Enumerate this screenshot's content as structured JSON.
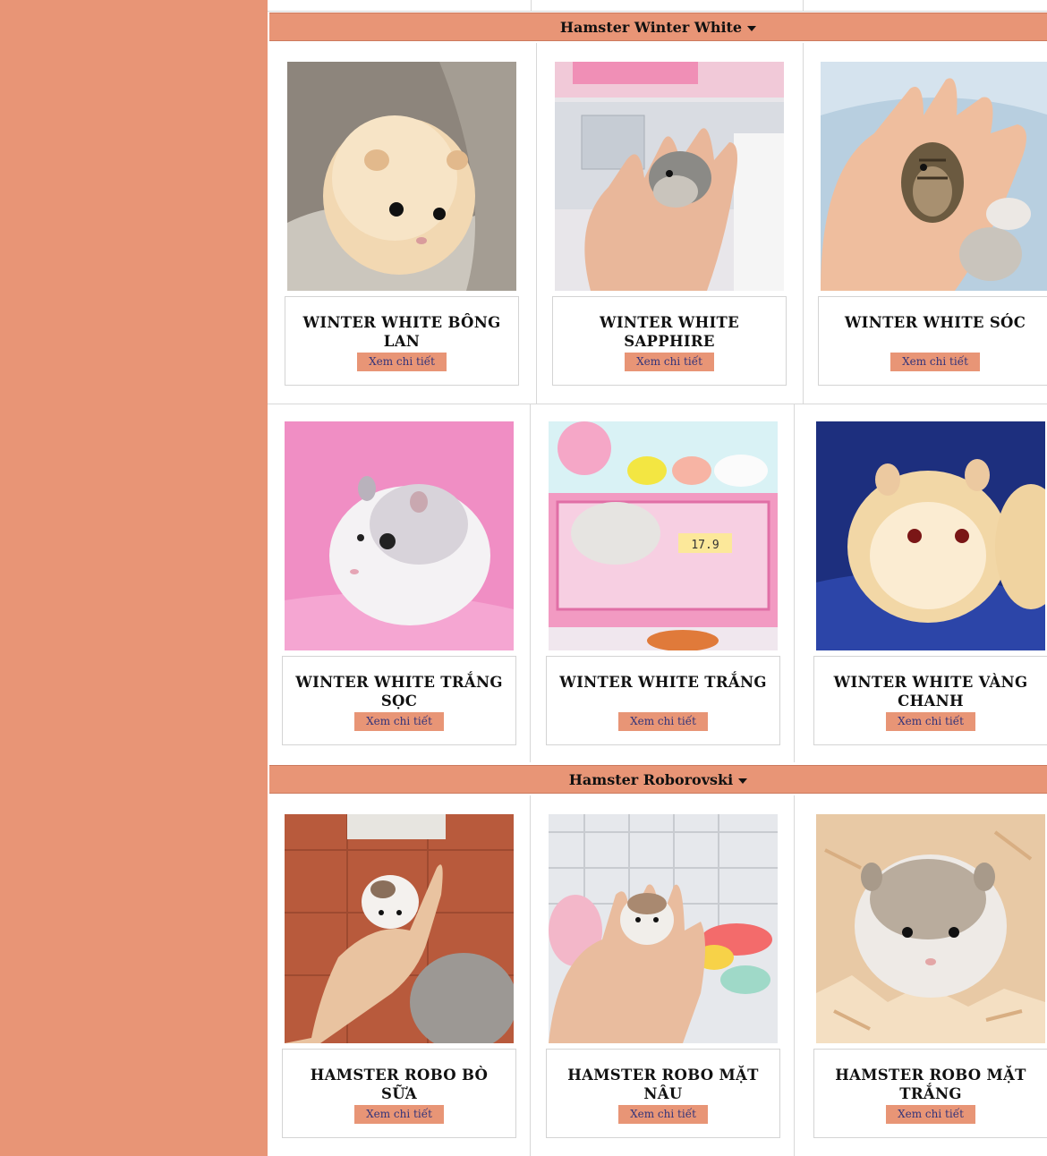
{
  "sections": [
    {
      "title": "Hamster Winter White",
      "products": [
        {
          "name": "WINTER WHITE BÔNG LAN",
          "button": "Xem chi tiết"
        },
        {
          "name": "WINTER WHITE SAPPHIRE",
          "button": "Xem chi tiết"
        },
        {
          "name": "WINTER WHITE SÓC",
          "button": "Xem chi tiết"
        },
        {
          "name": "WINTER WHITE TRẮNG SỌC",
          "button": "Xem chi tiết"
        },
        {
          "name": "WINTER WHITE TRẮNG",
          "button": "Xem chi tiết"
        },
        {
          "name": "WINTER WHITE VÀNG CHANH",
          "button": "Xem chi tiết"
        }
      ]
    },
    {
      "title": "Hamster Roborovski",
      "products": [
        {
          "name": "HAMSTER ROBO BÒ SỮA",
          "button": "Xem chi tiết"
        },
        {
          "name": "HAMSTER ROBO MẶT NÂU",
          "button": "Xem chi tiết"
        },
        {
          "name": "HAMSTER ROBO MẶT TRẮNG",
          "button": "Xem chi tiết"
        }
      ]
    }
  ],
  "colors": {
    "accent": "#e89576",
    "button_text": "#33347a",
    "border": "#d8d8d8"
  },
  "icons": {
    "section_toggle": "caret-down-icon"
  }
}
